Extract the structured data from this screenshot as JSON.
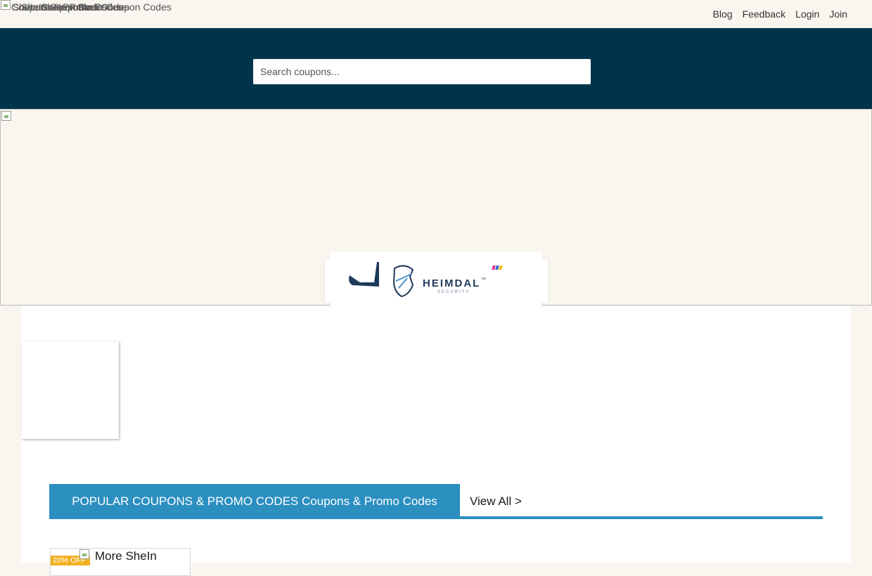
{
  "top": {
    "logo_alt_texts": [
      "Coupons & Promo Codes",
      "SheIn Coupon Codes",
      "SheIn Coupons",
      "SheIn Promo Codes",
      "SheIn Coupon Codes"
    ],
    "nav": [
      {
        "label": "Blog"
      },
      {
        "label": "Feedback"
      },
      {
        "label": "Login"
      },
      {
        "label": "Join"
      }
    ]
  },
  "search": {
    "placeholder": "Search coupons..."
  },
  "ad": {
    "brand": "HEIMDAL",
    "tm": "™",
    "tagline": "SECURITY",
    "bar_colors": [
      "#e0368c",
      "#3b67d6",
      "#f2c21b"
    ]
  },
  "popular": {
    "title": "POPULAR COUPONS & PROMO CODES Coupons & Promo Codes",
    "view_all": "View All >"
  },
  "coupon_card": {
    "badge": "20% OFF",
    "text": "More SheIn"
  },
  "colors": {
    "header_bg": "#00344b",
    "accent": "#2b8fc0",
    "badge": "#f2b01e",
    "page_bg": "#f8f6ee"
  }
}
